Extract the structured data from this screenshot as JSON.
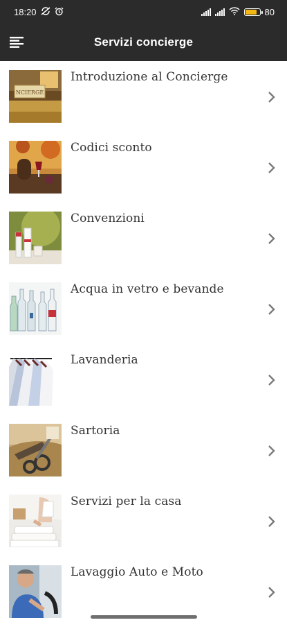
{
  "status_bar": {
    "time": "18:20",
    "battery": "80",
    "battery_level": 0.8,
    "icons": [
      "no-sync-icon",
      "alarm-icon",
      "signal-icon",
      "signal-icon",
      "wifi-icon",
      "battery-icon"
    ]
  },
  "app_bar": {
    "title": "Servizi concierge",
    "menu_icon": "menu-icon"
  },
  "services": [
    {
      "label": "Introduzione al Concierge",
      "image": "concierge-desk-image"
    },
    {
      "label": "Codici sconto",
      "image": "wine-autumn-image"
    },
    {
      "label": "Convenzioni",
      "image": "cosmetics-bottles-image"
    },
    {
      "label": "Acqua in vetro e bevande",
      "image": "glass-bottles-image"
    },
    {
      "label": "Lavanderia",
      "image": "shirts-on-hangers-image"
    },
    {
      "label": "Sartoria",
      "image": "tailoring-tools-image"
    },
    {
      "label": "Servizi per la casa",
      "image": "ironing-towels-image"
    },
    {
      "label": "Lavaggio Auto e Moto",
      "image": "man-in-car-image"
    }
  ],
  "colors": {
    "bar_background": "#2b2b2b",
    "text": "#333333",
    "chevron": "#7a7a7a",
    "battery": "#f2b712"
  }
}
